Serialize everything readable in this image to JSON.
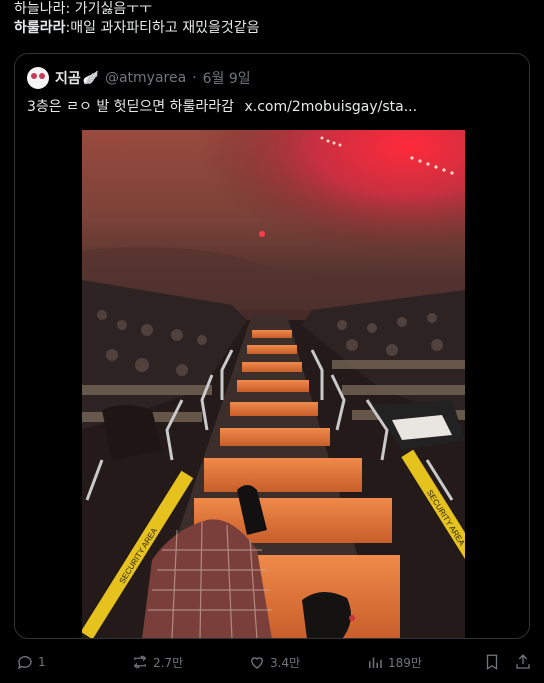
{
  "post": {
    "lines": [
      {
        "speaker": "하늘나라",
        "separator": ": ",
        "text": "가기싫음ㅜㅜ"
      },
      {
        "speaker": "하룰라라",
        "separator": ":",
        "text": "매일 과자파티하고 재밌을것같음"
      }
    ]
  },
  "quote": {
    "name": "지곰",
    "emoji": "🪽",
    "handle": "@atmyarea",
    "dot": "·",
    "date": "6월 9일",
    "text": "3층은 ㄹㅇ 발 헛딛으면 하룰라라감",
    "link": "x.com/2mobuisgay/sta..."
  },
  "image": {
    "tape_text": "SECURITY AREA"
  },
  "actions": {
    "reply": {
      "icon": "reply-icon",
      "count": "1"
    },
    "retweet": {
      "icon": "retweet-icon",
      "count": "2.7만"
    },
    "like": {
      "icon": "heart-icon",
      "count": "3.4만"
    },
    "views": {
      "icon": "views-icon",
      "count": "189만"
    },
    "bookmark": {
      "icon": "bookmark-icon"
    },
    "share": {
      "icon": "share-icon"
    }
  },
  "colors": {
    "background": "#000000",
    "text": "#e7e9ea",
    "muted": "#71767b",
    "border": "#2f3336",
    "stage_red": "#d8323a",
    "stairs_orange": "#e0733a",
    "tape_yellow": "#e6c21f"
  }
}
